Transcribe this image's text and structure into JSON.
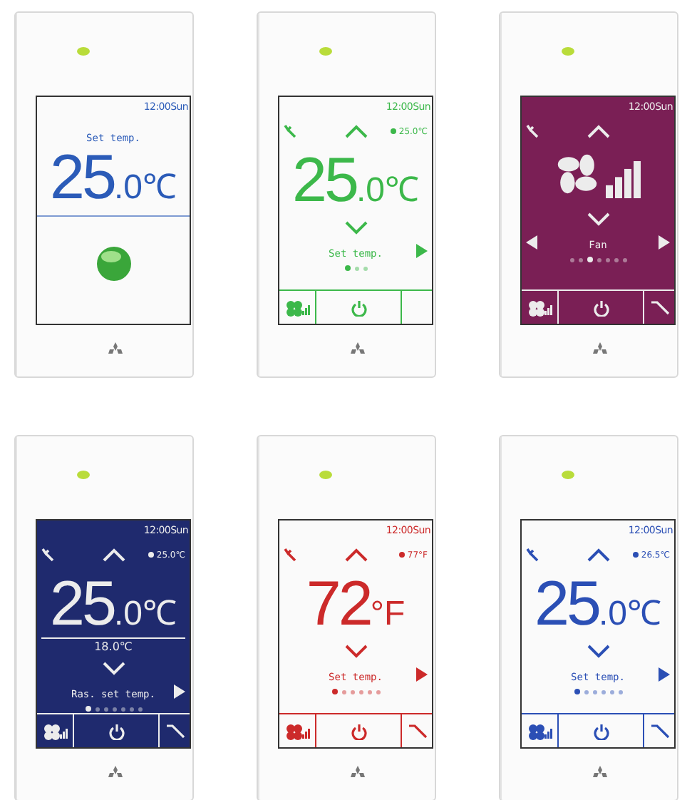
{
  "controllers": [
    {
      "kind": "home",
      "dark": false,
      "color": "#2b5bb8",
      "clock": "12:00Sun",
      "label": "Set temp.",
      "temperature": "25",
      "fraction": ".0",
      "unit": "℃"
    },
    {
      "kind": "temperature",
      "dark": false,
      "color": "#3cb84a",
      "clock": "12:00Sun",
      "reading": "25.0℃",
      "temperature": "25",
      "fraction": ".0",
      "unit": "℃",
      "label": "Set temp.",
      "pages": [
        {
          "selected": true
        },
        {
          "selected": false
        },
        {
          "selected": false
        }
      ],
      "tool_button": false
    },
    {
      "kind": "fan",
      "dark": true,
      "color": "#7a1f55",
      "clock": "12:00Sun",
      "label": "Fan",
      "left_arrow": true,
      "pages": [
        {
          "selected": false
        },
        {
          "selected": false
        },
        {
          "selected": true
        },
        {
          "selected": false
        },
        {
          "selected": false
        },
        {
          "selected": false
        },
        {
          "selected": false
        }
      ],
      "tool_button": true
    },
    {
      "kind": "temperature",
      "dark": true,
      "color": "#1f2a6e",
      "clock": "12:00Sun",
      "reading": "25.0℃",
      "temperature": "25",
      "fraction": ".0",
      "unit": "℃",
      "secondary": "18.0℃",
      "label": "Ras. set temp.",
      "pages": [
        {
          "selected": true
        },
        {
          "selected": false
        },
        {
          "selected": false
        },
        {
          "selected": false
        },
        {
          "selected": false
        },
        {
          "selected": false
        },
        {
          "selected": false
        }
      ],
      "tool_button": true
    },
    {
      "kind": "temperature",
      "dark": false,
      "color": "#cc2a2a",
      "clock": "12:00Sun",
      "reading": "77°F",
      "temperature": "72",
      "unit": "°F",
      "label": "Set temp.",
      "pages": [
        {
          "selected": true
        },
        {
          "selected": false
        },
        {
          "selected": false
        },
        {
          "selected": false
        },
        {
          "selected": false
        },
        {
          "selected": false
        }
      ],
      "tool_button": true
    },
    {
      "kind": "temperature",
      "dark": false,
      "color": "#2b4fb5",
      "clock": "12:00Sun",
      "reading": "26.5℃",
      "temperature": "25",
      "fraction": ".0",
      "unit": "℃",
      "label": "Set temp.",
      "pages": [
        {
          "selected": true
        },
        {
          "selected": false
        },
        {
          "selected": false
        },
        {
          "selected": false
        },
        {
          "selected": false
        },
        {
          "selected": false
        }
      ],
      "tool_button": true
    }
  ]
}
